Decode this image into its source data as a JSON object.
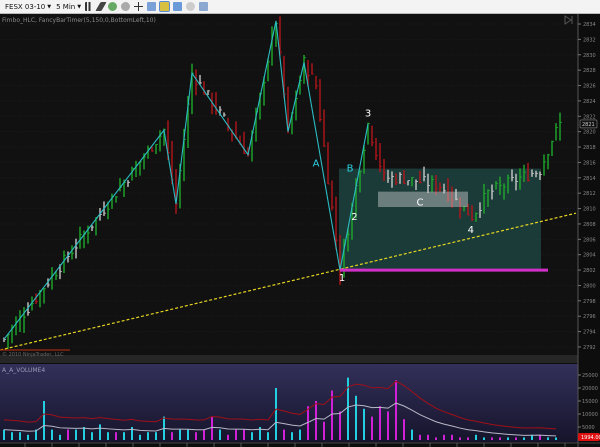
{
  "toolbar": {
    "instrument": "FESX 03-10",
    "interval": "5 Min",
    "icons": [
      "bar-type-icon",
      "drawing-tool-icon",
      "zoom-in-icon",
      "zoom-out-icon",
      "crosshair-icon",
      "properties-icon",
      "strategy-icon",
      "indicator-icon",
      "data-box-icon",
      "chart-trader-icon"
    ]
  },
  "indicator_label": "Fimbo_HLC, FancyBarTimer(5,150,0,BottomLeft,10)",
  "copyright": "© 2010 NinjaTrader, LLC",
  "volume_label": "A_A_VOLUME4",
  "colors": {
    "up": "#1faa2a",
    "down": "#b3151a",
    "doji": "#c8c8c8",
    "zigzag": "#2bbcc4",
    "trendline": "#e6d620",
    "support": "#d030c8",
    "box": "#1f4a47",
    "volume_up": "#22d0e0",
    "volume_down": "#d020d8",
    "vol_bg": "#24213f"
  },
  "chart_data": [
    {
      "type": "line",
      "title": "FESX 03-10 5 Min price",
      "ylim": [
        2791,
        2835
      ],
      "y_ticks": [
        "2834",
        "2832",
        "2830",
        "2828",
        "2826",
        "2824",
        "2822",
        "2820",
        "2818",
        "2816",
        "2814",
        "2812",
        "2810",
        "2808",
        "2806",
        "2804",
        "2802",
        "2800",
        "2798",
        "2796",
        "2794",
        "2792"
      ],
      "last_price": "2821",
      "bar_count": 140,
      "price_path": [
        [
          0,
          2793
        ],
        [
          40,
          2820.2
        ],
        [
          43,
          2810.6
        ],
        [
          47,
          2827.6
        ],
        [
          61,
          2817
        ],
        [
          68,
          2834.4
        ],
        [
          71,
          2820
        ],
        [
          75,
          2829
        ],
        [
          78,
          2826
        ],
        [
          84,
          2802
        ],
        [
          91,
          2821
        ],
        [
          95,
          2814
        ],
        [
          99,
          2814
        ],
        [
          109,
          2813
        ],
        [
          117,
          2809
        ],
        [
          121,
          2812
        ],
        [
          129,
          2814
        ],
        [
          134,
          2815
        ],
        [
          137,
          2819
        ],
        [
          139,
          2821
        ]
      ],
      "zigzag": [
        [
          0,
          2793
        ],
        [
          40,
          2820.2
        ],
        [
          43,
          2810.6
        ],
        [
          47,
          2827.6
        ],
        [
          61,
          2817
        ],
        [
          68,
          2834.4
        ],
        [
          71,
          2820
        ],
        [
          75,
          2829
        ],
        [
          84,
          2802
        ],
        [
          91,
          2821
        ]
      ],
      "trendline": [
        [
          -1,
          2791.6
        ],
        [
          143,
          2809.4
        ]
      ],
      "support_line": {
        "price": 2802,
        "from": 84,
        "to": 136
      },
      "zone_box": {
        "from": 84,
        "to": 134,
        "top": 2815.2,
        "bottom": 2802
      },
      "c_box": {
        "from": 93.5,
        "to": 116,
        "top": 2812.2,
        "bottom": 2810.2
      },
      "annotations": [
        {
          "text": "A",
          "bar": 78,
          "price": 2815.5,
          "color": "#2bd0e0"
        },
        {
          "text": "B",
          "bar": 86.5,
          "price": 2814.8,
          "color": "#2bd0e0"
        },
        {
          "text": "3",
          "bar": 91,
          "price": 2822,
          "color": "#ffffff"
        },
        {
          "text": "2",
          "bar": 87.6,
          "price": 2808.5,
          "color": "#ffffff"
        },
        {
          "text": "C",
          "bar": 104,
          "price": 2810.4,
          "color": "#ffffff"
        },
        {
          "text": "4",
          "bar": 116.7,
          "price": 2806.8,
          "color": "#ffffff"
        },
        {
          "text": "1",
          "bar": 84.5,
          "price": 2800.6,
          "color": "#ffffff"
        }
      ]
    },
    {
      "type": "bar",
      "title": "A_A_VOLUME4",
      "ylim": [
        0,
        28000
      ],
      "y_ticks": [
        "25000",
        "20000",
        "15000",
        "10000",
        "5000"
      ],
      "last_value": "1994.00",
      "bar_spacing_bars": 2,
      "values_k": [
        4,
        3,
        3,
        2,
        4,
        15,
        4,
        2,
        4,
        4,
        5,
        3,
        6,
        3,
        3,
        3,
        5,
        2,
        3,
        3,
        9,
        3,
        4,
        4,
        3,
        4,
        9,
        4,
        2,
        4,
        4,
        3,
        5,
        3,
        20,
        4,
        3,
        4,
        13,
        15,
        7,
        19,
        11,
        24,
        17,
        12,
        9,
        13,
        11,
        23,
        8,
        4,
        2,
        2,
        1,
        2,
        2,
        1,
        1,
        2,
        1,
        1,
        1,
        1,
        1,
        1,
        2,
        2,
        1,
        1
      ]
    }
  ]
}
